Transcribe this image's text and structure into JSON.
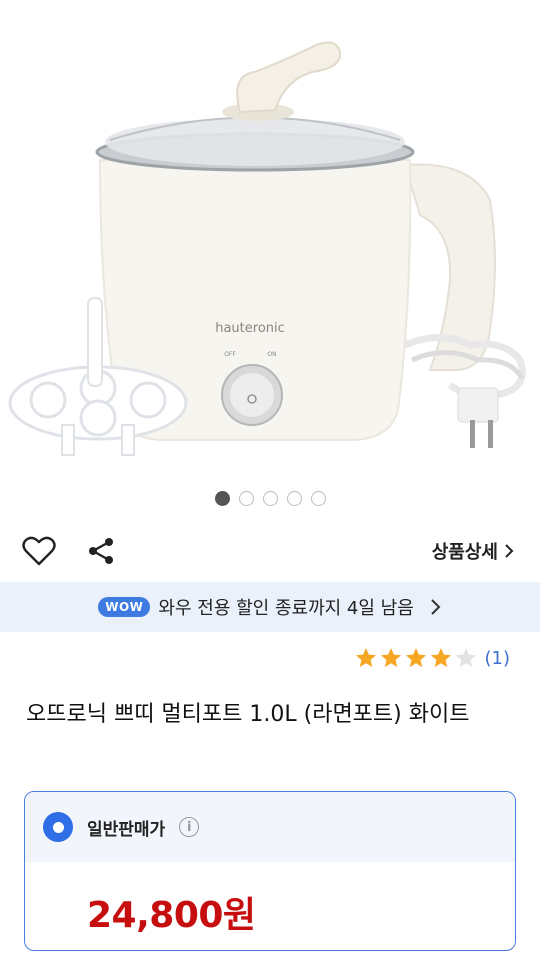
{
  "product_image": {
    "brand_text": "hauteronic",
    "switch_off": "OFF",
    "switch_on": "ON"
  },
  "carousel": {
    "total": 5,
    "active": 1
  },
  "actions": {
    "detail_label": "상품상세"
  },
  "wow": {
    "badge": "WOW",
    "text": "와우 전용 할인 종료까지 4일 남음"
  },
  "rating": {
    "stars": 4,
    "max": 5,
    "count": "(1)"
  },
  "title": "오뜨로닉 쁘띠 멀티포트 1.0L (라면포트) 화이트",
  "price": {
    "label": "일반판매가",
    "value": "24,800원"
  },
  "colors": {
    "accent": "#3d7be0",
    "price": "#c70e0e",
    "star": "#f5a623"
  }
}
